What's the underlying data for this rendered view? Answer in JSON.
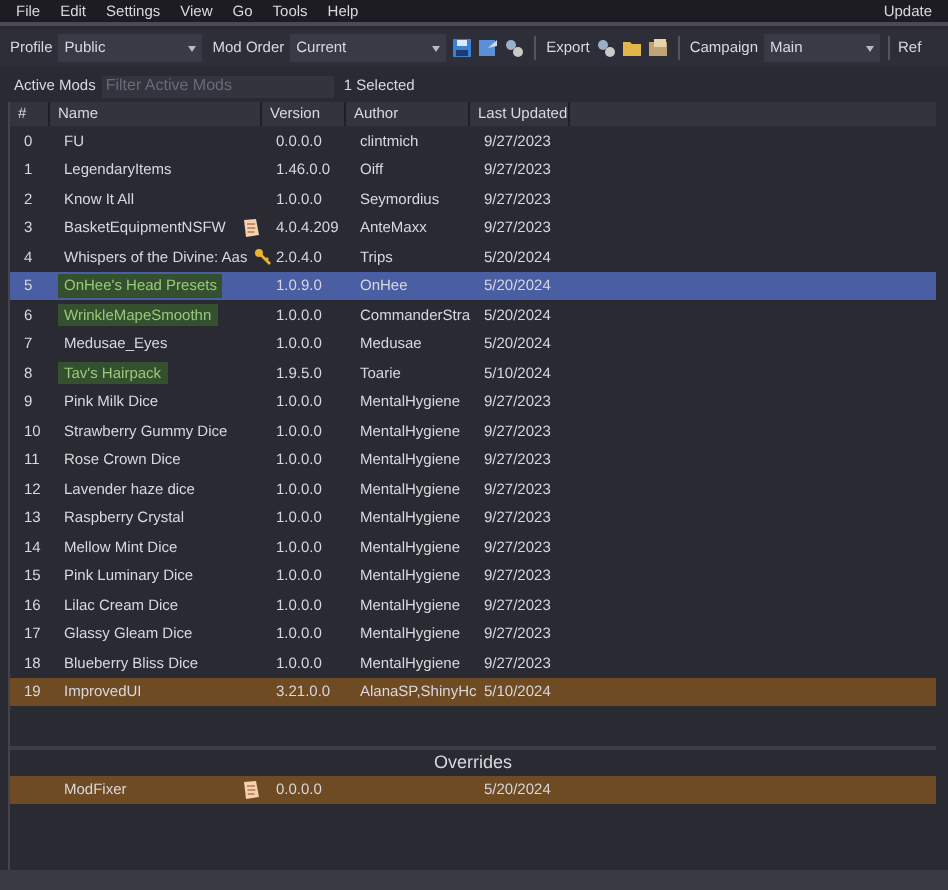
{
  "menu": [
    "File",
    "Edit",
    "Settings",
    "View",
    "Go",
    "Tools",
    "Help"
  ],
  "menu_right": "Update",
  "toolbar": {
    "profile_label": "Profile",
    "profile": "Public",
    "order_label": "Mod Order",
    "order": "Current",
    "export_label": "Export",
    "campaign_label": "Campaign",
    "campaign": "Main",
    "cut_button": "Ref"
  },
  "active_mods": {
    "label": "Active Mods",
    "placeholder": "Filter Active Mods",
    "count": "1 Selected"
  },
  "table": {
    "columns": [
      "#",
      "Name",
      "Version",
      "Author",
      "Last Updated"
    ],
    "rows": [
      {
        "index": "0",
        "name": "FU",
        "version": "0.0.0.0",
        "author": "clintmich",
        "updated": "9/27/2023",
        "selected": false,
        "highlight": false,
        "override": false
      },
      {
        "index": "1",
        "name": "LegendaryItems",
        "version": "1.46.0.0",
        "author": "Oiff",
        "updated": "9/27/2023",
        "selected": false,
        "highlight": false,
        "override": false
      },
      {
        "index": "2",
        "name": "Know It All",
        "version": "1.0.0.0",
        "author": "Seymordius",
        "updated": "9/27/2023",
        "selected": false,
        "highlight": false,
        "override": false
      },
      {
        "index": "3",
        "name": "BasketEquipmentNSFW",
        "version": "4.0.4.209",
        "author": "AnteMaxx",
        "updated": "9/27/2023",
        "selected": false,
        "highlight": false,
        "override": false,
        "kind": "note"
      },
      {
        "index": "4",
        "name": "Whispers of the Divine: Aas",
        "version": "2.0.4.0",
        "author": "Trips",
        "updated": "5/20/2024",
        "selected": false,
        "highlight": false,
        "override": false,
        "kind": "key"
      },
      {
        "index": "5",
        "name": "OnHee's Head Presets",
        "version": "1.0.9.0",
        "author": "OnHee",
        "updated": "5/20/2024",
        "selected": true,
        "highlight": true,
        "override": false
      },
      {
        "index": "6",
        "name": "WrinkleMapeSmoothn",
        "version": "1.0.0.0",
        "author": "CommanderStra",
        "updated": "5/20/2024",
        "selected": false,
        "highlight": true,
        "override": false
      },
      {
        "index": "7",
        "name": "Medusae_Eyes",
        "version": "1.0.0.0",
        "author": "Medusae",
        "updated": "5/20/2024",
        "selected": false,
        "highlight": false,
        "override": false
      },
      {
        "index": "8",
        "name": "Tav's Hairpack",
        "version": "1.9.5.0",
        "author": "Toarie",
        "updated": "5/10/2024",
        "selected": false,
        "highlight": true,
        "override": false
      },
      {
        "index": "9",
        "name": "Pink Milk Dice",
        "version": "1.0.0.0",
        "author": "MentalHygiene",
        "updated": "9/27/2023",
        "selected": false,
        "highlight": false,
        "override": false
      },
      {
        "index": "10",
        "name": "Strawberry Gummy Dice",
        "version": "1.0.0.0",
        "author": "MentalHygiene",
        "updated": "9/27/2023",
        "selected": false,
        "highlight": false,
        "override": false
      },
      {
        "index": "11",
        "name": "Rose Crown Dice",
        "version": "1.0.0.0",
        "author": "MentalHygiene",
        "updated": "9/27/2023",
        "selected": false,
        "highlight": false,
        "override": false
      },
      {
        "index": "12",
        "name": "Lavender haze dice",
        "version": "1.0.0.0",
        "author": "MentalHygiene",
        "updated": "9/27/2023",
        "selected": false,
        "highlight": false,
        "override": false
      },
      {
        "index": "13",
        "name": "Raspberry Crystal",
        "version": "1.0.0.0",
        "author": "MentalHygiene",
        "updated": "9/27/2023",
        "selected": false,
        "highlight": false,
        "override": false
      },
      {
        "index": "14",
        "name": "Mellow Mint Dice",
        "version": "1.0.0.0",
        "author": "MentalHygiene",
        "updated": "9/27/2023",
        "selected": false,
        "highlight": false,
        "override": false
      },
      {
        "index": "15",
        "name": "Pink Luminary Dice",
        "version": "1.0.0.0",
        "author": "MentalHygiene",
        "updated": "9/27/2023",
        "selected": false,
        "highlight": false,
        "override": false
      },
      {
        "index": "16",
        "name": "Lilac Cream Dice",
        "version": "1.0.0.0",
        "author": "MentalHygiene",
        "updated": "9/27/2023",
        "selected": false,
        "highlight": false,
        "override": false
      },
      {
        "index": "17",
        "name": "Glassy Gleam Dice",
        "version": "1.0.0.0",
        "author": "MentalHygiene",
        "updated": "9/27/2023",
        "selected": false,
        "highlight": false,
        "override": false
      },
      {
        "index": "18",
        "name": "Blueberry Bliss Dice",
        "version": "1.0.0.0",
        "author": "MentalHygiene",
        "updated": "9/27/2023",
        "selected": false,
        "highlight": false,
        "override": false
      },
      {
        "index": "19",
        "name": "ImprovedUI",
        "version": "3.21.0.0",
        "author": "AlanaSP,ShinyHc",
        "updated": "5/10/2024",
        "selected": false,
        "highlight": false,
        "override": true
      }
    ]
  },
  "overrides": {
    "title": "Overrides",
    "rows": [
      {
        "name": "ModFixer",
        "version": "0.0.0.0",
        "updated": "5/20/2024",
        "kind": "note",
        "override": true
      }
    ]
  }
}
